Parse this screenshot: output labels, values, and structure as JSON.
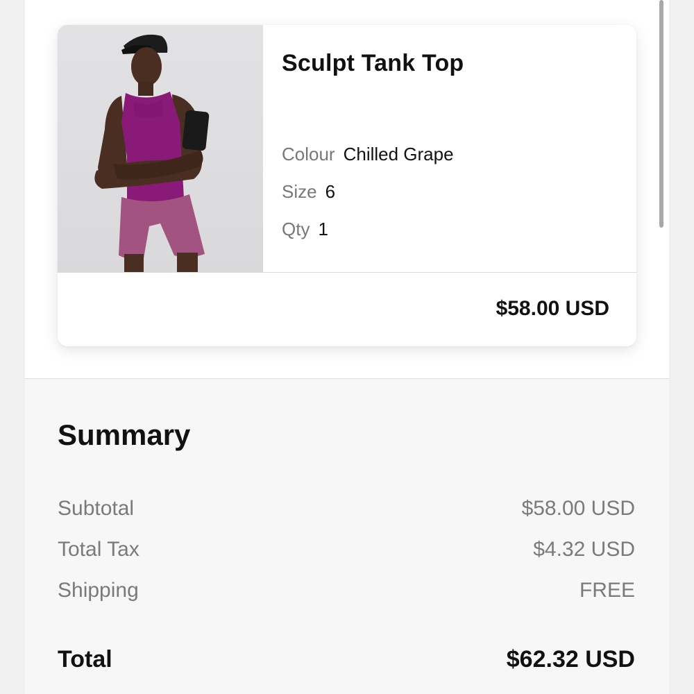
{
  "cart_item": {
    "name": "Sculpt Tank Top",
    "image_alt": "Model wearing Sculpt Tank Top in Chilled Grape",
    "attributes": [
      {
        "label": "Colour",
        "value": "Chilled Grape"
      },
      {
        "label": "Size",
        "value": "6"
      },
      {
        "label": "Qty",
        "value": "1"
      }
    ],
    "price": "$58.00 USD",
    "colors": {
      "tank": "#8a1a78",
      "shorts": "#a3537f",
      "background": "#dcdcde"
    }
  },
  "summary": {
    "title": "Summary",
    "rows": [
      {
        "label": "Subtotal",
        "value": "$58.00 USD"
      },
      {
        "label": "Total Tax",
        "value": "$4.32 USD"
      },
      {
        "label": "Shipping",
        "value": "FREE"
      }
    ],
    "total_label": "Total",
    "total_value": "$62.32 USD"
  }
}
